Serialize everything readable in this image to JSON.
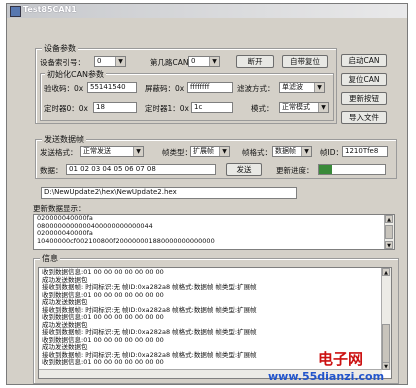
{
  "window": {
    "title": "Test85CAN1"
  },
  "device": {
    "group_title": "设备参数",
    "index_label": "设备索引号：",
    "index_value": "0",
    "channel_label": "第几路CAN：",
    "channel_value": "0",
    "disconnect_btn": "断开",
    "self_reset_btn": "自带复位"
  },
  "init": {
    "group_title": "初始化CAN参数",
    "acc_code_label": "验收码：0x",
    "acc_code_value": "55141540",
    "mask_code_label": "屏蔽码：0x",
    "mask_code_value": "ffffffff",
    "filter_label": "滤波方式：",
    "filter_value": "单滤波",
    "timer0_label": "定时器0：0x",
    "timer0_value": "18",
    "timer1_label": "定时器1：0x",
    "timer1_value": "1c",
    "mode_label": "模式：",
    "mode_value": "正常模式"
  },
  "side_buttons": {
    "start_can": "启动CAN",
    "reset_can": "复位CAN",
    "update_fw": "更新按钮",
    "import_file": "导入文件"
  },
  "send": {
    "group_title": "发送数据帧",
    "format_label": "发送格式：",
    "format_value": "正常发送",
    "frame_type_label": "帧类型：",
    "frame_type_value": "扩展帧",
    "frame_format_label": "帧格式：",
    "frame_format_value": "数据帧",
    "frame_id_label": "帧ID：",
    "frame_id_value": "1210Tfe8",
    "data_label": "数据：",
    "data_value": "01 02 03 04 05 06 07 08",
    "send_btn": "发送",
    "progress_label": "更新进度：",
    "progress_fraction": 0.2
  },
  "file_path": "D:\\NewUpdate2\\hex\\NewUpdate2.hex",
  "update_display": {
    "label": "更新数据显示：",
    "rows": [
      "020000040000fa",
      "0800000000000400000000000044",
      "020000040000fa",
      "10400000cf002100800f200000001880000000000000"
    ]
  },
  "info": {
    "group_title": "信息",
    "rows": [
      "收到数据信息:01 00 00 00 00 00 00 00",
      "成功发送数据包",
      "接收到数据帧:    时间标识:无    帧ID:0xa282a8  帧格式:数据帧  帧类型:扩展帧",
      "收到数据信息:01 00 00 00 00 00 00 00",
      "成功发送数据包",
      "接收到数据帧:    时间标识:无    帧ID:0xa282a8  帧格式:数据帧  帧类型:扩展帧",
      "收到数据信息:01 00 00 00 00 00 00 00",
      "成功发送数据包",
      "接收到数据帧:    时间标识:无    帧ID:0xa282a8  帧格式:数据帧  帧类型:扩展帧",
      "收到数据信息:01 00 00 00 00 00 00 00",
      "成功发送数据包",
      "接收到数据帧:    时间标识:无    帧ID:0xa282a8  帧格式:数据帧  帧类型:扩展帧",
      "收到数据信息:01 00 00 00 00 00 00 00"
    ]
  },
  "watermark": {
    "logo": "电子网",
    "site": "www.55dianzi.com"
  },
  "colors": {
    "window_bg": "#d4d0c8",
    "progress_fill": "#3a8a3a",
    "watermark_red": "#cc1111",
    "watermark_blue": "#2255cc"
  }
}
